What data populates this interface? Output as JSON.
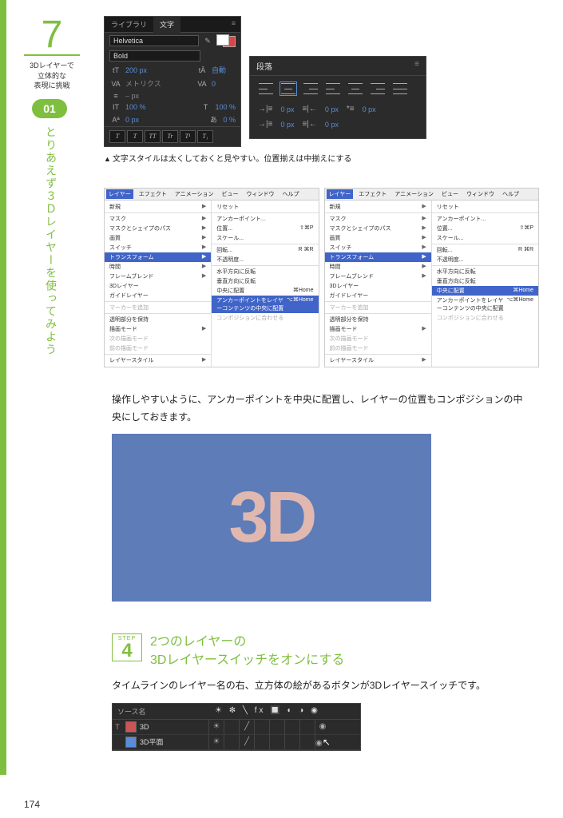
{
  "chapter": {
    "number": "7",
    "title_line1": "3Dレイヤーで",
    "title_line2": "立体的な",
    "title_line3": "表現に挑戦",
    "step_badge": "01",
    "vertical_heading": "とりあえず３Ｄレイヤーを使ってみよう"
  },
  "char_panel": {
    "tab_library": "ライブラリ",
    "tab_character": "文字",
    "font": "Helvetica",
    "weight": "Bold",
    "size": "200 px",
    "leading_auto": "自動",
    "kerning_label": "VA",
    "kerning_val": "メトリクス",
    "tracking_label": "VA",
    "tracking_val": "0",
    "tsume": "– px",
    "vscale": "100 %",
    "hscale": "100 %",
    "baseline": "0 px",
    "aki": "0 %",
    "btn_T": "T",
    "btn_I": "T",
    "btn_TT": "TT",
    "btn_Tt": "Tr",
    "btn_sup": "T¹",
    "btn_sub": "T₁"
  },
  "para_panel": {
    "title": "段落",
    "indent_left": "0 px",
    "indent_right": "0 px",
    "indent_first": "0 px",
    "space_before": "0 px",
    "space_after": "0 px"
  },
  "caption1": "文字スタイルは太くしておくと見やすい。位置揃えは中揃えにする",
  "menu": {
    "bar": [
      "レイヤー",
      "エフェクト",
      "アニメーション",
      "ビュー",
      "ウィンドウ",
      "ヘルプ"
    ],
    "new": "新規",
    "mask": "マスク",
    "mask_shape": "マスクとシェイプのパス",
    "quality": "画質",
    "switch": "スイッチ",
    "transform": "トランスフォーム",
    "time": "時間",
    "frame_blend": "フレームブレンド",
    "threed": "3Dレイヤー",
    "guide": "ガイドレイヤー",
    "add_marker": "マーカーを追加",
    "preserve_transparency": "透明部分を保持",
    "blend_mode": "描画モード",
    "next_blend": "次の描画モード",
    "prev_blend": "前の描画モード",
    "layer_style": "レイヤースタイル",
    "sub_reset": "リセット",
    "sub_anchor": "アンカーポイント...",
    "sub_position": "位置...",
    "sub_scale": "スケール...",
    "sub_rotation": "回転...",
    "sub_opacity": "不透明度...",
    "sub_flip_h": "水平方向に反転",
    "sub_flip_v": "垂直方向に反転",
    "sub_center": "中央に配置",
    "sub_anchor_center": "アンカーポイントをレイヤーコンテンツの中央に配置",
    "sub_fit_comp": "コンポジションに合わせる",
    "shortcut_p": "⇧⌘P",
    "shortcut_r": "R ⌘R",
    "shortcut_home": "⌘Home",
    "shortcut_opt_home": "⌥⌘Home"
  },
  "body1": "操作しやすいように、アンカーポイントを中央に配置し、レイヤーの位置もコンポジションの中央にしておきます。",
  "preview_text": "3D",
  "step4": {
    "label": "STEP",
    "num": "4",
    "title_line1": "2つのレイヤーの",
    "title_line2": "3Dレイヤースイッチをオンにする"
  },
  "body2": "タイムラインのレイヤー名の右、立方体の絵があるボタンが3Dレイヤースイッチです。",
  "timeline": {
    "header_source": "ソース名",
    "header_icons": "☀ ✻ ╲ fx 🔲 ◐ ◑ ◉",
    "row1_name": "3D",
    "row2_name": "3D平面"
  },
  "page_number": "174"
}
